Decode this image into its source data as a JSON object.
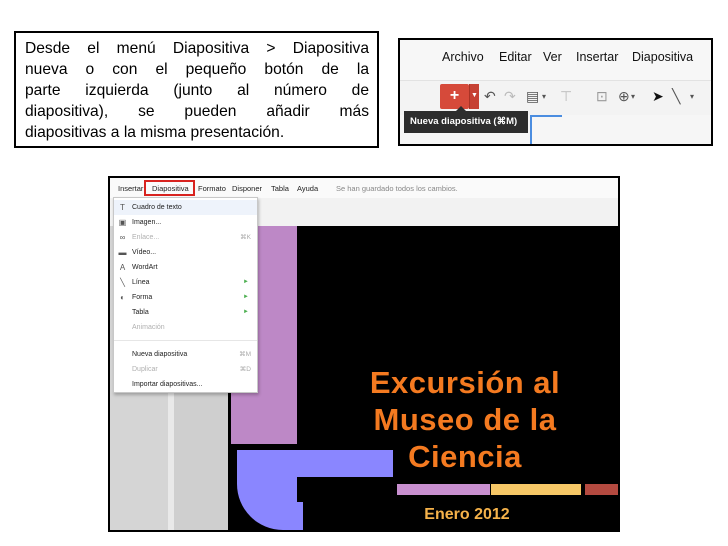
{
  "callout": {
    "lines": [
      "Desde el menú Diapositiva > Diapositiva",
      "nueva  o con el  pequeño botón de la",
      "parte izquierda (junto al número de",
      "diapositiva), se pueden añadir más",
      "diapositivas a la misma presentación."
    ]
  },
  "toolbar_shot": {
    "menu": [
      "Archivo",
      "Editar",
      "Ver",
      "Insertar",
      "Diapositiva"
    ],
    "add_button": "+",
    "tooltip": "Nueva diapositiva (⌘M)"
  },
  "editor_shot": {
    "menu": [
      "Insertar",
      "Diapositiva",
      "Formato",
      "Disponer",
      "Tabla",
      "Ayuda"
    ],
    "saved_status": "Se han guardado todos los cambios.",
    "dropdown": [
      {
        "label": "Cuadro de texto",
        "icon": "T",
        "shortcut": "",
        "submenu": false,
        "disabled": false
      },
      {
        "label": "Imagen...",
        "icon": "▣",
        "shortcut": "",
        "submenu": false,
        "disabled": false
      },
      {
        "label": "Enlace...",
        "icon": "∞",
        "shortcut": "⌘K",
        "submenu": false,
        "disabled": true
      },
      {
        "label": "Vídeo...",
        "icon": "▬",
        "shortcut": "",
        "submenu": false,
        "disabled": false
      },
      {
        "label": "WordArt",
        "icon": "A",
        "shortcut": "",
        "submenu": false,
        "disabled": false
      },
      {
        "label": "Línea",
        "icon": "╲",
        "shortcut": "",
        "submenu": true,
        "disabled": false
      },
      {
        "label": "Forma",
        "icon": "◐",
        "shortcut": "",
        "submenu": true,
        "disabled": false
      },
      {
        "label": "Tabla",
        "icon": "",
        "shortcut": "",
        "submenu": true,
        "disabled": false
      },
      {
        "label": "Animación",
        "icon": "",
        "shortcut": "",
        "submenu": false,
        "disabled": true
      },
      {
        "label": "Nueva diapositiva",
        "icon": "",
        "shortcut": "⌘M",
        "submenu": false,
        "disabled": false
      },
      {
        "label": "Duplicar",
        "icon": "",
        "shortcut": "⌘D",
        "submenu": false,
        "disabled": true
      },
      {
        "label": "Importar diapositivas...",
        "icon": "",
        "shortcut": "",
        "submenu": false,
        "disabled": false
      }
    ],
    "slide_title": "Excursión al Museo de la Ciencia",
    "slide_title_lines": [
      "Excursión al",
      "Museo de la",
      "Ciencia"
    ],
    "slide_date": "Enero 2012"
  },
  "colors": {
    "accent_red": "#d8231f",
    "add_button": "#d64a3a",
    "slide_title": "#f47a20",
    "slide_purple": "#bd88c6",
    "slide_blue": "#8a86ff"
  }
}
